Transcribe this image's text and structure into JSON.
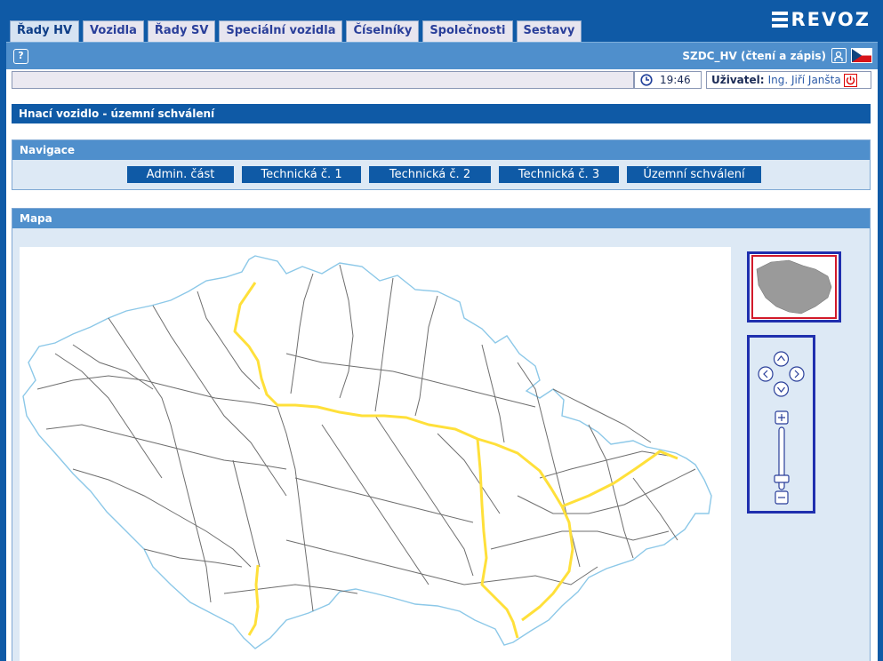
{
  "tabs": [
    "Řady HV",
    "Vozidla",
    "Řady SV",
    "Speciální vozidla",
    "Číselníky",
    "Společnosti",
    "Sestavy"
  ],
  "active_tab": "Řady HV",
  "logo": {
    "text": "REVOZ"
  },
  "toolbar": {
    "help": "?",
    "session": "SZDC_HV (čtení a zápis)"
  },
  "status": {
    "time": "19:46",
    "user_label": "Uživatel:",
    "user_name": "Ing. Jiří Janšta"
  },
  "page": {
    "title": "Hnací vozidlo - územní schválení"
  },
  "navigation": {
    "title": "Navigace",
    "buttons": [
      "Admin. část",
      "Technická č. 1",
      "Technická č. 2",
      "Technická č. 3",
      "Územní schválení"
    ]
  },
  "map": {
    "title": "Mapa"
  },
  "colors": {
    "brand_blue": "#0f5aa6",
    "panel_head": "#4f8fcc",
    "route_yellow": "#ffe03a",
    "border": "#8cc8e8"
  }
}
